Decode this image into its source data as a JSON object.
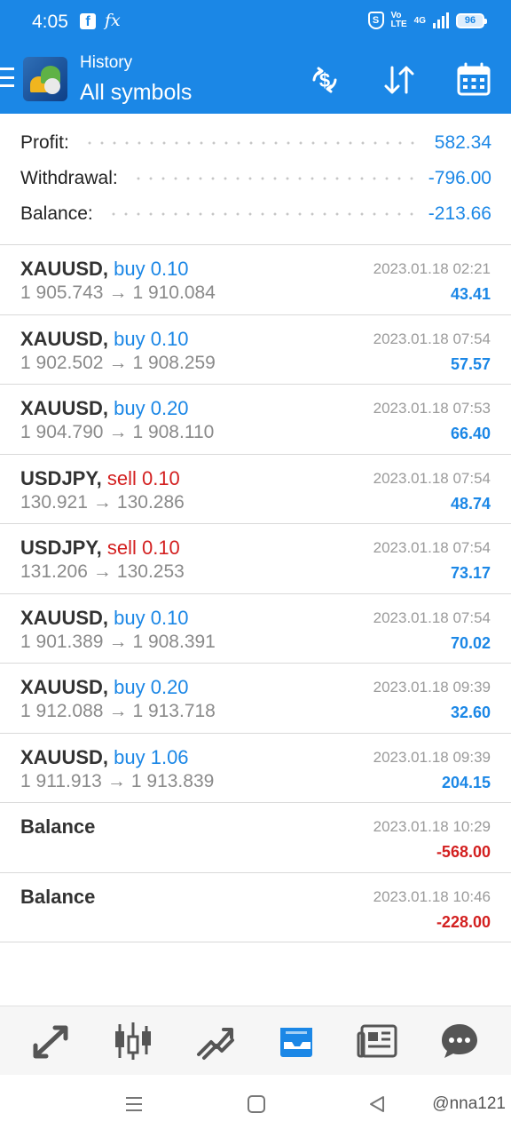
{
  "status_bar": {
    "time": "4:05",
    "facebook_icon": "f",
    "fx_icon": "fx",
    "shield_icon": "S",
    "volte_line1": "Vo",
    "volte_line2": "LTE",
    "network": "4G",
    "battery": "96"
  },
  "app_bar": {
    "title": "History",
    "subtitle": "All symbols",
    "actions": [
      "dollar-sync-icon",
      "sort-icon",
      "calendar-icon"
    ]
  },
  "summary": {
    "profit_label": "Profit:",
    "profit_value": "582.34",
    "withdrawal_label": "Withdrawal:",
    "withdrawal_value": "-796.00",
    "balance_label": "Balance:",
    "balance_value": "-213.66"
  },
  "deals": [
    {
      "symbol": "XAUUSD,",
      "side": "buy",
      "volume": "buy 0.10",
      "open": "1 905.743",
      "close": "1 910.084",
      "datetime": "2023.01.18 02:21",
      "profit": "43.41"
    },
    {
      "symbol": "XAUUSD,",
      "side": "buy",
      "volume": "buy 0.10",
      "open": "1 902.502",
      "close": "1 908.259",
      "datetime": "2023.01.18 07:54",
      "profit": "57.57"
    },
    {
      "symbol": "XAUUSD,",
      "side": "buy",
      "volume": "buy 0.20",
      "open": "1 904.790",
      "close": "1 908.110",
      "datetime": "2023.01.18 07:53",
      "profit": "66.40"
    },
    {
      "symbol": "USDJPY,",
      "side": "sell",
      "volume": "sell 0.10",
      "open": "130.921",
      "close": "130.286",
      "datetime": "2023.01.18 07:54",
      "profit": "48.74"
    },
    {
      "symbol": "USDJPY,",
      "side": "sell",
      "volume": "sell 0.10",
      "open": "131.206",
      "close": "130.253",
      "datetime": "2023.01.18 07:54",
      "profit": "73.17"
    },
    {
      "symbol": "XAUUSD,",
      "side": "buy",
      "volume": "buy 0.10",
      "open": "1 901.389",
      "close": "1 908.391",
      "datetime": "2023.01.18 07:54",
      "profit": "70.02"
    },
    {
      "symbol": "XAUUSD,",
      "side": "buy",
      "volume": "buy 0.20",
      "open": "1 912.088",
      "close": "1 913.718",
      "datetime": "2023.01.18 09:39",
      "profit": "32.60"
    },
    {
      "symbol": "XAUUSD,",
      "side": "buy",
      "volume": "buy 1.06",
      "open": "1 911.913",
      "close": "1 913.839",
      "datetime": "2023.01.18 09:39",
      "profit": "204.15"
    }
  ],
  "balance_ops": [
    {
      "label": "Balance",
      "datetime": "2023.01.18 10:29",
      "amount": "-568.00"
    },
    {
      "label": "Balance",
      "datetime": "2023.01.18 10:46",
      "amount": "-228.00"
    }
  ],
  "arrow": "→",
  "bottom_nav": [
    "quotes-icon",
    "chart-icon",
    "trade-icon",
    "history-icon",
    "news-icon",
    "chat-icon"
  ],
  "bottom_nav_active": "history-icon",
  "watermark": "@nna121",
  "colors": {
    "accent": "#1b87e6",
    "loss": "#d32020",
    "text": "#333333",
    "muted": "#8a8a8a"
  }
}
